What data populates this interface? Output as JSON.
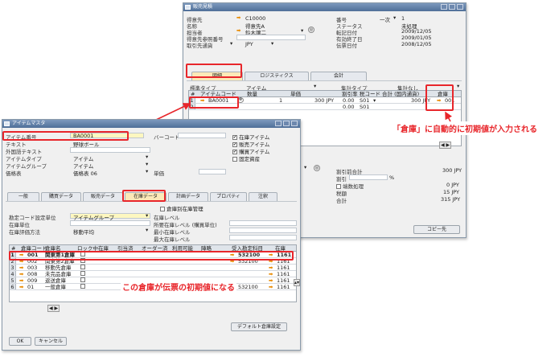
{
  "win1": {
    "title": "販売見積",
    "left_fields": [
      {
        "label": "得意先",
        "value": "C10000"
      },
      {
        "label": "名称",
        "value": "得意先A"
      },
      {
        "label": "担当者",
        "value": "鈴木譲二"
      },
      {
        "label": "得意先参照番号",
        "value": ""
      },
      {
        "label": "取引先通貨",
        "value": "JPY"
      }
    ],
    "right_fields": [
      {
        "label": "番号",
        "prefix": "一次",
        "value": "1"
      },
      {
        "label": "ステータス",
        "value": "未処理"
      },
      {
        "label": "転記日付",
        "value": "2009/12/05"
      },
      {
        "label": "有効終了日",
        "value": "2009/01/05"
      },
      {
        "label": "伝票日付",
        "value": "2008/12/05"
      }
    ],
    "tabs": [
      "明細",
      "ロジスティクス",
      "会計"
    ],
    "item_type_label": "標準タイプ",
    "item_type_value": "アイテム",
    "summary_type_label": "集計タイプ",
    "summary_type_value": "集計なし",
    "grid_headers": [
      "#",
      "アイテムコード",
      "数量",
      "単価",
      "割引率",
      "税コード",
      "合計 (国内通貨)",
      "倉庫"
    ],
    "grid_rows": [
      {
        "num": "1",
        "code": "BA0001",
        "qty": "1",
        "price": "300 JPY",
        "disc": "0.00",
        "tax": "S01",
        "total": "300 JPY",
        "wh": "001"
      },
      {
        "num": "2",
        "code": "",
        "qty": "",
        "price": "",
        "disc": "0.00",
        "tax": "S01",
        "total": "",
        "wh": ""
      }
    ],
    "totals": [
      {
        "label": "割引前合計",
        "value": "300 JPY"
      },
      {
        "label": "割引",
        "value": "%"
      },
      {
        "label": "端数処理",
        "value": "0 JPY"
      },
      {
        "label": "税額",
        "value": "15 JPY"
      },
      {
        "label": "合計",
        "value": "315 JPY"
      }
    ],
    "copy_button": "コピー先"
  },
  "win2": {
    "title": "アイテムマスタ",
    "fields": [
      {
        "label": "アイテム番号",
        "value": "BA0001"
      },
      {
        "label": "テキスト",
        "value": "野球ボール"
      },
      {
        "label": "外国語テキスト",
        "value": ""
      },
      {
        "label": "アイテムタイプ",
        "value": "アイテム"
      },
      {
        "label": "アイテムグループ",
        "value": "アイテム"
      },
      {
        "label": "価格表",
        "value": "価格表 06"
      }
    ],
    "barcode_label": "バーコード",
    "unit_price_label": "単価",
    "checkboxes": [
      {
        "label": "在庫アイテム",
        "checked": true
      },
      {
        "label": "販売アイテム",
        "checked": true
      },
      {
        "label": "購買アイテム",
        "checked": true
      },
      {
        "label": "固定資産",
        "checked": false
      }
    ],
    "tabs": [
      "一般",
      "購買データ",
      "販売データ",
      "在庫データ",
      "計画データ",
      "プロパティ",
      "注釈"
    ],
    "active_tab": 3,
    "warehouse_mgmt_label": "倉庫別在庫管理",
    "left_inv": [
      {
        "label": "勘定コード設定単位",
        "value": "アイテムグループ"
      },
      {
        "label": "在庫単位",
        "value": ""
      },
      {
        "label": "在庫評価方法",
        "value": "移動平均"
      }
    ],
    "right_inv": [
      {
        "label": "在庫レベル",
        "value": ""
      },
      {
        "label": "所要在庫レベル (購買単位)",
        "value": ""
      },
      {
        "label": "最小在庫レベル",
        "value": ""
      },
      {
        "label": "最大在庫レベル",
        "value": ""
      }
    ],
    "wh_headers": [
      "#",
      "倉庫コード",
      "倉庫名",
      "ロック中",
      "在庫",
      "引当済",
      "オーダー済",
      "利用可能",
      "陣略",
      "受入勘定科目",
      "在庫"
    ],
    "wh_rows": [
      {
        "num": "1",
        "code": "001",
        "name": "関東第1倉庫",
        "acct": "532100",
        "inv": "1161"
      },
      {
        "num": "2",
        "code": "002",
        "name": "関東第2倉庫",
        "acct": "532100",
        "inv": "1161"
      },
      {
        "num": "3",
        "code": "003",
        "name": "移動先倉庫",
        "acct": "532100",
        "inv": "1161"
      },
      {
        "num": "4",
        "code": "008",
        "name": "未完品倉庫",
        "acct": "532100",
        "inv": "1161"
      },
      {
        "num": "5",
        "code": "009",
        "name": "返送倉庫",
        "acct": "532100",
        "inv": "1161"
      },
      {
        "num": "6",
        "code": "01",
        "name": "一般倉庫",
        "acct": "532100",
        "inv": "1161"
      }
    ],
    "default_wh_button": "デフォルト倉庫設定",
    "ok_button": "OK",
    "cancel_button": "キャンセル"
  },
  "annotations": {
    "auto_default": "「倉庫」に自動的に初期値が入力される",
    "wh_default": "この倉庫が伝票の初期値になる"
  },
  "colors": {
    "highlight_red": "#e8262b",
    "arrow_orange": "#e88a00",
    "title_blue": "#5675a0"
  }
}
